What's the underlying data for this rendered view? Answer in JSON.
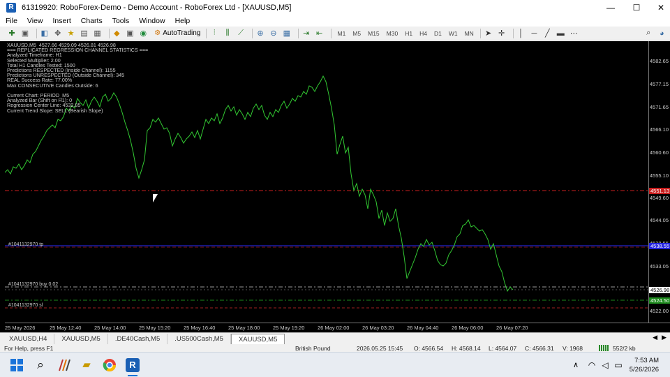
{
  "window": {
    "title": "61319920: RoboForex-Demo - Demo Account - RoboForex Ltd - [XAUUSD,M5]",
    "controls": [
      "—",
      "☐",
      "✕"
    ]
  },
  "menu": [
    "File",
    "View",
    "Insert",
    "Charts",
    "Tools",
    "Window",
    "Help"
  ],
  "toolbar": {
    "autotrading_label": "AutoTrading",
    "timeframes": [
      "M1",
      "M5",
      "M15",
      "M30",
      "H1",
      "H4",
      "D1",
      "W1",
      "MN"
    ]
  },
  "chart": {
    "header": "XAUUSD,M5  4527.66 4529.09 4526.81 4526.98",
    "stats_lines": [
      "=== REPLICATED REGRESSION CHANNEL STATISTICS ===",
      "Analyzed Timeframe: H1",
      "Selected Multiplier: 2.00",
      "Total H1 Candles Tested: 1500",
      "Predictions RESPECTED (Inside Channel): 1155",
      "Predictions UNRESPECTED (Outside Channel): 345",
      "REAL Success Rate: 77.00%",
      "Max CONSECUTIVE Candles Outside: 6",
      "",
      "Current Chart: PERIOD_M5",
      "Analyzed Bar (Shift on H1): 0",
      "Regression Center Line: 4532.85",
      "Current Trend Slope: SELL (Bearish Slope)"
    ],
    "order_lines": {
      "tp": "#1041132970 tp",
      "buy": "#1041132970 buy 0.02",
      "sl": "#1041132970 sl"
    },
    "price_labels": [
      "4582.65",
      "4577.15",
      "4571.65",
      "4566.10",
      "4560.60",
      "4555.10",
      "4549.60",
      "4544.05",
      "4538.55",
      "4533.05",
      "4522.00"
    ],
    "price_boxes": {
      "red": "4551.13",
      "blue": "4538.55",
      "current": "4526.98",
      "green": "4524.50"
    },
    "time_labels": [
      "25 May 2026",
      "25 May 12:40",
      "25 May 14:00",
      "25 May 15:20",
      "25 May 16:40",
      "25 May 18:00",
      "25 May 19:20",
      "26 May 02:00",
      "26 May 03:20",
      "26 May 04:40",
      "26 May 06:00",
      "26 May 07:20"
    ],
    "colors": {
      "price_line": "#32c832",
      "red_line": "#c81e1e",
      "blue_line": "#2d2dff",
      "tp_dash": "#7a1515",
      "grey_dash": "#9a9a9a",
      "green_dash": "#1d8a1d"
    }
  },
  "tabs": [
    "XAUUSD,H4",
    "XAUUSD,M5",
    ".DE40Cash,M5",
    ".US500Cash,M5",
    "XAUUSD,M5"
  ],
  "active_tab": 4,
  "status": {
    "help": "For Help, press F1",
    "profile": "British Pound",
    "datetime": "2026.05.25 15:45",
    "open": "O: 4566.54",
    "high": "H: 4568.14",
    "low": "L: 4564.07",
    "close": "C: 4566.31",
    "volume": "V: 1968",
    "traffic": "552/2 kb"
  },
  "taskbar": {
    "time": "7:53 AM",
    "date": "5/26/2026"
  }
}
